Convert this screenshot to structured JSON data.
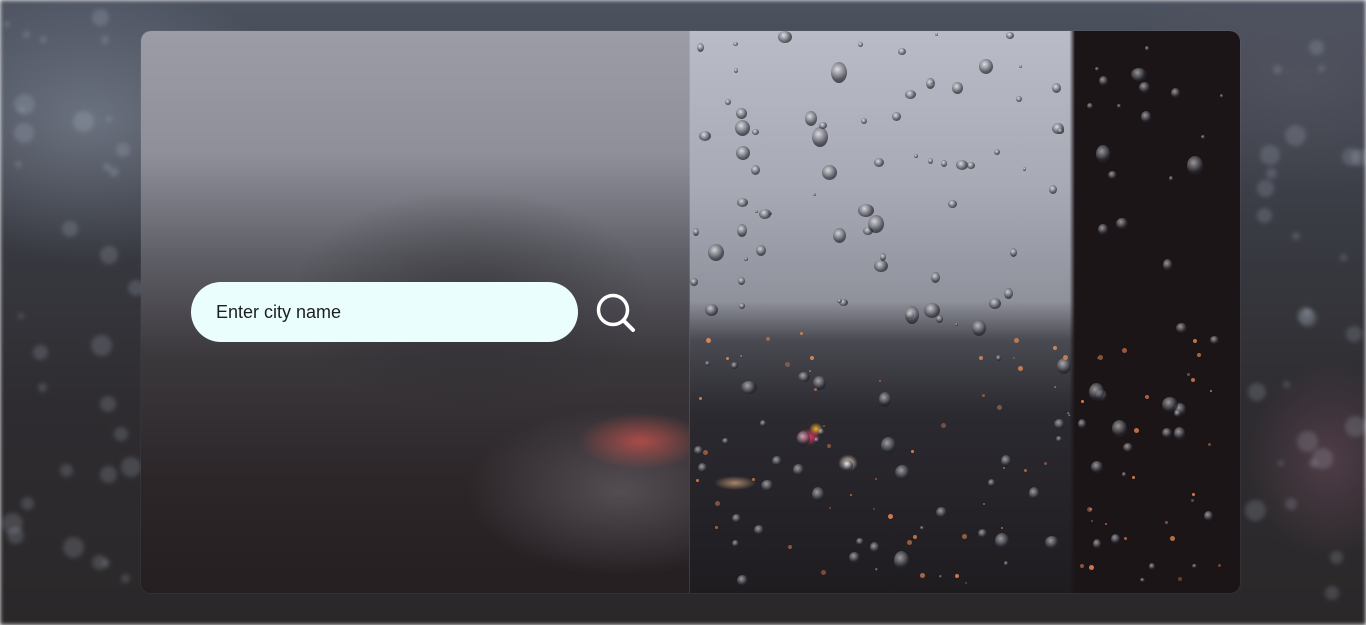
{
  "search": {
    "placeholder": "Enter city name",
    "value": ""
  },
  "icons": {
    "search_button": "search-icon"
  },
  "colors": {
    "input_background": "#eafffd",
    "icon_stroke": "#ffffff"
  }
}
